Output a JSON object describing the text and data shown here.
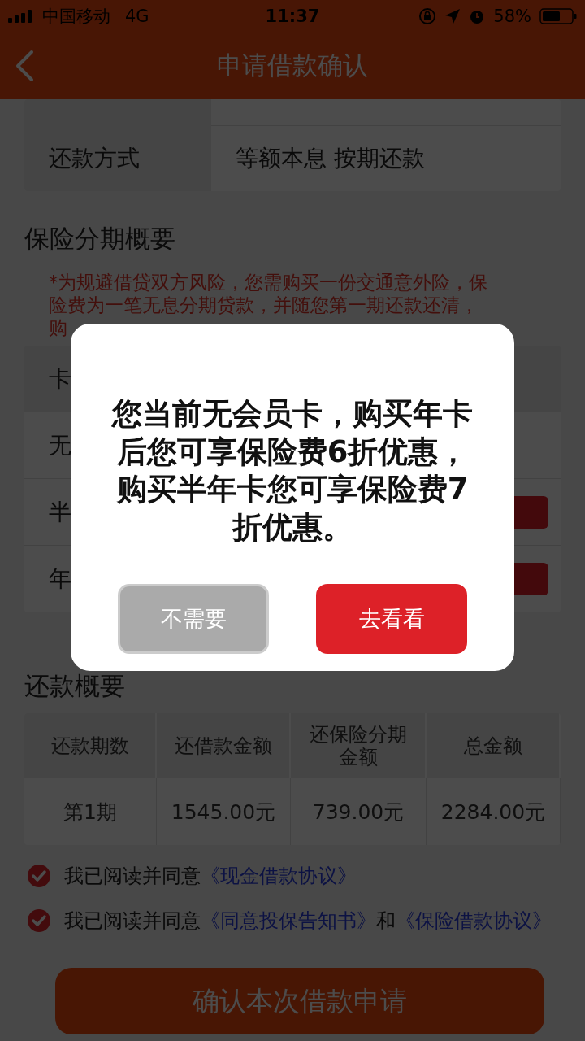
{
  "status_bar": {
    "carrier": "中国移动",
    "network": "4G",
    "time": "11:37",
    "battery": "58%"
  },
  "header": {
    "title": "申请借款确认"
  },
  "loan_rows": [
    {
      "label": "还款方式",
      "value": "等额本息 按期还款"
    }
  ],
  "insurance": {
    "title": "保险分期概要",
    "note_lines": [
      "*为规避借贷双方风险，您需购买一份交通意外险，保",
      "险费为一笔无息分期贷款，并随您第一期还款还清，",
      "购"
    ],
    "rows": [
      {
        "label": "卡",
        "kind": "header"
      },
      {
        "label": "无",
        "kind": "plain"
      },
      {
        "label": "半",
        "kind": "action"
      },
      {
        "label": "年",
        "kind": "action"
      }
    ]
  },
  "repayment": {
    "title": "还款概要",
    "columns": [
      "还款期数",
      "还借款金额",
      "还保险分期金额",
      "总金额"
    ],
    "rows": [
      [
        "第1期",
        "1545.00元",
        "739.00元",
        "2284.00元"
      ]
    ]
  },
  "agreements": [
    {
      "checked": true,
      "parts": [
        {
          "kind": "text",
          "text": "我已阅读并同意"
        },
        {
          "kind": "link",
          "text": "《现金借款协议》"
        }
      ]
    },
    {
      "checked": true,
      "parts": [
        {
          "kind": "text",
          "text": "我已阅读并同意"
        },
        {
          "kind": "link",
          "text": "《同意投保告知书》"
        },
        {
          "kind": "text",
          "text": "和"
        },
        {
          "kind": "link",
          "text": "《保险借款协议》"
        }
      ]
    }
  ],
  "confirm_button": "确认本次借款申请",
  "dialog": {
    "message": "您当前无会员卡，购买年卡后您可享保险费6折优惠，购买半年卡您可享保险费7折优惠。",
    "buttons": [
      {
        "kind": "secondary",
        "label": "不需要"
      },
      {
        "kind": "primary",
        "label": "去看看"
      }
    ]
  }
}
